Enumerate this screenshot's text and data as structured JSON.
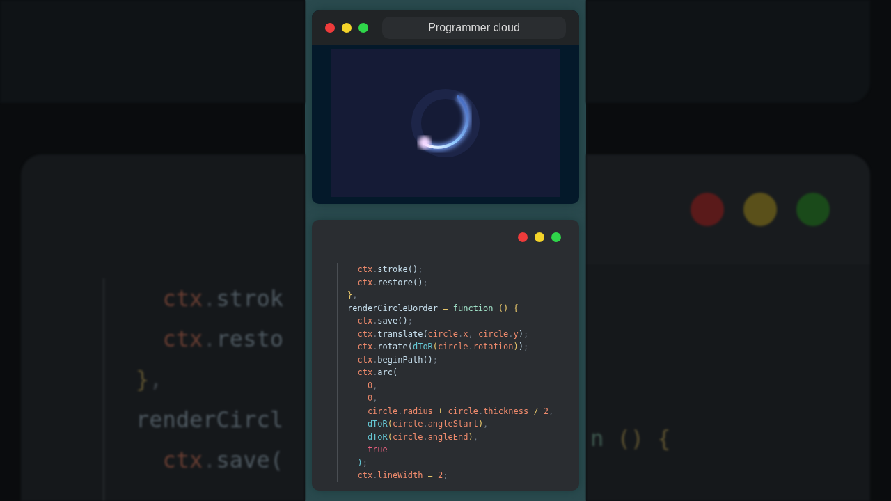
{
  "backdrop": {
    "left_lines": [
      [
        {
          "text": "  ctx",
          "kind": "var"
        },
        {
          "text": ".",
          "kind": "punct"
        },
        {
          "text": "strok",
          "kind": "method"
        }
      ],
      [
        {
          "text": "  ctx",
          "kind": "var"
        },
        {
          "text": ".",
          "kind": "punct"
        },
        {
          "text": "resto",
          "kind": "method"
        }
      ],
      [
        {
          "text": "}",
          "kind": "bracket"
        },
        {
          "text": ",",
          "kind": "punct"
        }
      ],
      [
        {
          "text": "renderCircl",
          "kind": "method"
        }
      ],
      [
        {
          "text": "  ctx",
          "kind": "var"
        },
        {
          "text": ".",
          "kind": "punct"
        },
        {
          "text": "save(",
          "kind": "method"
        }
      ]
    ],
    "right_line": [
      {
        "text": "n ",
        "kind": "keyword"
      },
      {
        "text": "() {",
        "kind": "bracket"
      }
    ]
  },
  "preview_window": {
    "title": "Programmer cloud"
  },
  "code_window": {
    "lines": [
      [
        {
          "text": "  ctx",
          "kind": "var"
        },
        {
          "text": ".",
          "kind": "punct"
        },
        {
          "text": "stroke()",
          "kind": "method"
        },
        {
          "text": ";",
          "kind": "punct"
        }
      ],
      [
        {
          "text": "  ctx",
          "kind": "var"
        },
        {
          "text": ".",
          "kind": "punct"
        },
        {
          "text": "restore()",
          "kind": "method"
        },
        {
          "text": ";",
          "kind": "punct"
        }
      ],
      [
        {
          "text": "}",
          "kind": "bracket"
        },
        {
          "text": ",",
          "kind": "punct"
        }
      ],
      [
        {
          "text": "renderCircleBorder",
          "kind": "method"
        },
        {
          "text": " = ",
          "kind": "op"
        },
        {
          "text": "function",
          "kind": "keyword"
        },
        {
          "text": " () {",
          "kind": "bracket"
        }
      ],
      [
        {
          "text": "  ctx",
          "kind": "var"
        },
        {
          "text": ".",
          "kind": "punct"
        },
        {
          "text": "save()",
          "kind": "method"
        },
        {
          "text": ";",
          "kind": "punct"
        }
      ],
      [
        {
          "text": "  ctx",
          "kind": "var"
        },
        {
          "text": ".",
          "kind": "punct"
        },
        {
          "text": "translate(",
          "kind": "method"
        },
        {
          "text": "circle",
          "kind": "var"
        },
        {
          "text": ".",
          "kind": "punct"
        },
        {
          "text": "x",
          "kind": "var"
        },
        {
          "text": ", ",
          "kind": "punct"
        },
        {
          "text": "circle",
          "kind": "var"
        },
        {
          "text": ".",
          "kind": "punct"
        },
        {
          "text": "y",
          "kind": "var"
        },
        {
          "text": ")",
          "kind": "method"
        },
        {
          "text": ";",
          "kind": "punct"
        }
      ],
      [
        {
          "text": "  ctx",
          "kind": "var"
        },
        {
          "text": ".",
          "kind": "punct"
        },
        {
          "text": "rotate(",
          "kind": "method"
        },
        {
          "text": "dToR",
          "kind": "call"
        },
        {
          "text": "(",
          "kind": "bracket"
        },
        {
          "text": "circle",
          "kind": "var"
        },
        {
          "text": ".",
          "kind": "punct"
        },
        {
          "text": "rotation",
          "kind": "var"
        },
        {
          "text": ")",
          "kind": "bracket"
        },
        {
          "text": ")",
          "kind": "method"
        },
        {
          "text": ";",
          "kind": "punct"
        }
      ],
      [
        {
          "text": "  ctx",
          "kind": "var"
        },
        {
          "text": ".",
          "kind": "punct"
        },
        {
          "text": "beginPath()",
          "kind": "method"
        },
        {
          "text": ";",
          "kind": "punct"
        }
      ],
      [
        {
          "text": "  ctx",
          "kind": "var"
        },
        {
          "text": ".",
          "kind": "punct"
        },
        {
          "text": "arc(",
          "kind": "method"
        }
      ],
      [
        {
          "text": "    0",
          "kind": "var"
        },
        {
          "text": ",",
          "kind": "punct"
        }
      ],
      [
        {
          "text": "    0",
          "kind": "var"
        },
        {
          "text": ",",
          "kind": "punct"
        }
      ],
      [
        {
          "text": "    circle",
          "kind": "var"
        },
        {
          "text": ".",
          "kind": "punct"
        },
        {
          "text": "radius",
          "kind": "var"
        },
        {
          "text": " + ",
          "kind": "op"
        },
        {
          "text": "circle",
          "kind": "var"
        },
        {
          "text": ".",
          "kind": "punct"
        },
        {
          "text": "thickness",
          "kind": "var"
        },
        {
          "text": " / ",
          "kind": "op"
        },
        {
          "text": "2",
          "kind": "var"
        },
        {
          "text": ",",
          "kind": "punct"
        }
      ],
      [
        {
          "text": "    dToR",
          "kind": "call"
        },
        {
          "text": "(",
          "kind": "bracket"
        },
        {
          "text": "circle",
          "kind": "var"
        },
        {
          "text": ".",
          "kind": "punct"
        },
        {
          "text": "angleStart",
          "kind": "var"
        },
        {
          "text": ")",
          "kind": "bracket"
        },
        {
          "text": ",",
          "kind": "punct"
        }
      ],
      [
        {
          "text": "    dToR",
          "kind": "call"
        },
        {
          "text": "(",
          "kind": "bracket"
        },
        {
          "text": "circle",
          "kind": "var"
        },
        {
          "text": ".",
          "kind": "punct"
        },
        {
          "text": "angleEnd",
          "kind": "var"
        },
        {
          "text": ")",
          "kind": "bracket"
        },
        {
          "text": ",",
          "kind": "punct"
        }
      ],
      [
        {
          "text": "    true",
          "kind": "literal"
        }
      ],
      [
        {
          "text": "  )",
          "kind": "call"
        },
        {
          "text": ";",
          "kind": "punct"
        }
      ],
      [
        {
          "text": "  ctx",
          "kind": "var"
        },
        {
          "text": ".",
          "kind": "punct"
        },
        {
          "text": "lineWidth",
          "kind": "var"
        },
        {
          "text": " = ",
          "kind": "op"
        },
        {
          "text": "2",
          "kind": "var"
        },
        {
          "text": ";",
          "kind": "punct"
        }
      ]
    ]
  }
}
